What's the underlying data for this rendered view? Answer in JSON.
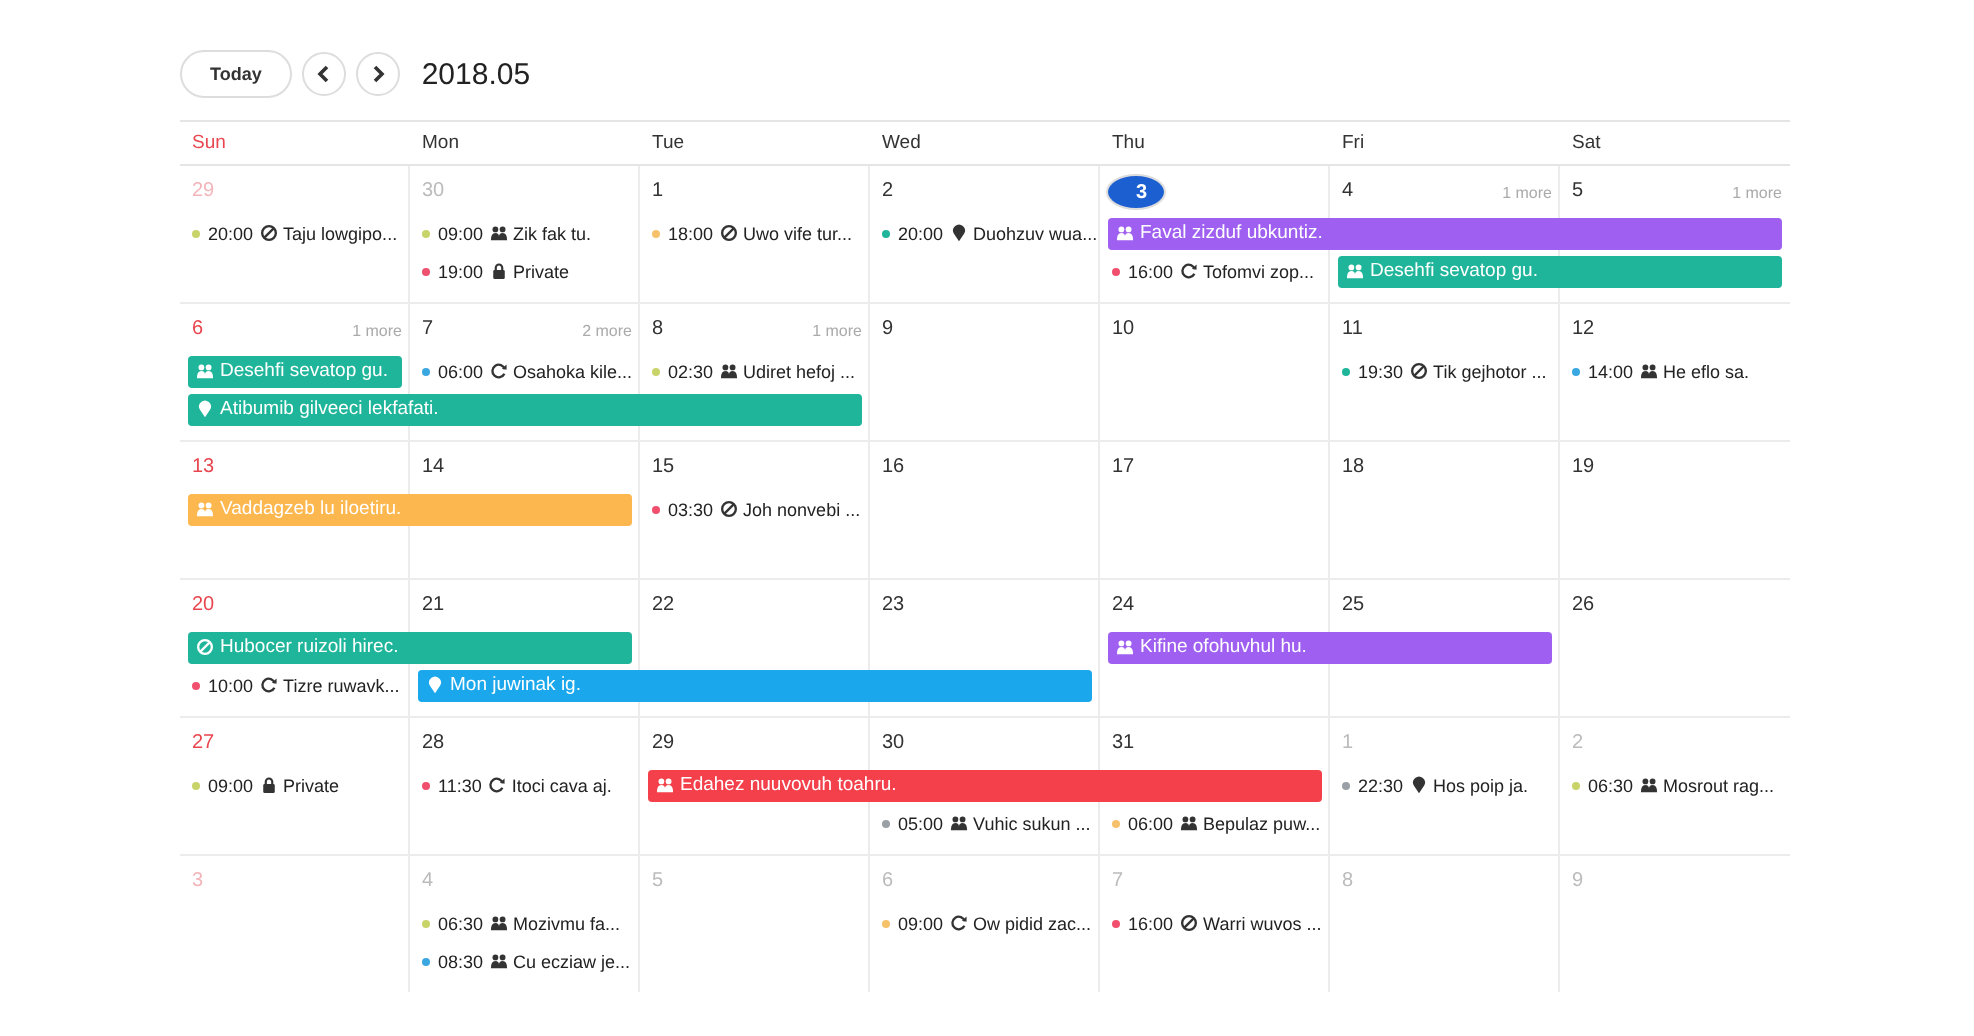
{
  "toolbar": {
    "today_button": "Today",
    "title": "2018.05"
  },
  "weekdays": [
    "Sun",
    "Mon",
    "Tue",
    "Wed",
    "Thu",
    "Fri",
    "Sat"
  ],
  "weeks": [
    {
      "days": [
        {
          "date": "29",
          "other_month": true,
          "today": false
        },
        {
          "date": "30",
          "other_month": true,
          "today": false
        },
        {
          "date": "1",
          "other_month": false,
          "today": false
        },
        {
          "date": "2",
          "other_month": false,
          "today": false
        },
        {
          "date": "3",
          "other_month": false,
          "today": true
        },
        {
          "date": "4",
          "other_month": false,
          "today": false,
          "more": "1 more"
        },
        {
          "date": "5",
          "other_month": false,
          "today": false,
          "more": "1 more"
        }
      ],
      "lanes": [
        [
          {
            "kind": "cancelled",
            "time": "20:00",
            "title": "Taju lowgipo...",
            "color": "#c8d46a"
          },
          {
            "kind": "meeting",
            "time": "09:00",
            "title": "Zik fak tu.",
            "color": "#c8d46a"
          },
          {
            "kind": "cancelled",
            "time": "18:00",
            "title": "Uwo vife tur...",
            "color": "#f5c26b"
          },
          {
            "kind": "location",
            "time": "20:00",
            "title": "Duohzuv wua...",
            "color": "#1fb59a"
          },
          {
            "kind": "meeting",
            "title": "Faval zizduf ubkuntiz.",
            "color": "#9f5ff1"
          },
          {
            "kind": "continued"
          },
          {
            "kind": "continued"
          }
        ],
        [
          {
            "kind": "empty"
          },
          {
            "kind": "private",
            "time": "19:00",
            "title": "Private",
            "color": "#f0506e"
          },
          {
            "kind": "empty"
          },
          {
            "kind": "empty"
          },
          {
            "kind": "recurring",
            "time": "16:00",
            "title": "Tofomvi zop...",
            "color": "#f0506e"
          },
          {
            "kind": "meeting",
            "title": "Desehfi sevatop gu.",
            "color": "#1fb59a"
          },
          {
            "kind": "continued"
          }
        ]
      ]
    },
    {
      "days": [
        {
          "date": "6",
          "other_month": false,
          "today": false,
          "more": "1 more"
        },
        {
          "date": "7",
          "other_month": false,
          "today": false,
          "more": "2 more"
        },
        {
          "date": "8",
          "other_month": false,
          "today": false,
          "more": "1 more"
        },
        {
          "date": "9",
          "other_month": false,
          "today": false
        },
        {
          "date": "10",
          "other_month": false,
          "today": false
        },
        {
          "date": "11",
          "other_month": false,
          "today": false
        },
        {
          "date": "12",
          "other_month": false,
          "today": false
        }
      ],
      "lanes": [
        [
          {
            "kind": "meeting",
            "title": "Desehfi sevatop gu.",
            "color": "#1fb59a"
          },
          {
            "kind": "recurring",
            "time": "06:00",
            "title": "Osahoka kile...",
            "color": "#3aa7e0"
          },
          {
            "kind": "meeting",
            "time": "02:30",
            "title": "Udiret hefoj ...",
            "color": "#c8d46a"
          },
          {
            "kind": "empty"
          },
          {
            "kind": "empty"
          },
          {
            "kind": "cancelled",
            "time": "19:30",
            "title": "Tik gejhotor ...",
            "color": "#1fb59a"
          },
          {
            "kind": "meeting",
            "time": "14:00",
            "title": "He eflo sa.",
            "color": "#3aa7e0"
          }
        ],
        [
          {
            "kind": "location",
            "title": "Atibumib gilveeci lekfafati.",
            "color": "#1fb59a"
          },
          {
            "kind": "continued"
          },
          {
            "kind": "continued"
          }
        ]
      ]
    },
    {
      "days": [
        {
          "date": "13",
          "other_month": false,
          "today": false
        },
        {
          "date": "14",
          "other_month": false,
          "today": false
        },
        {
          "date": "15",
          "other_month": false,
          "today": false
        },
        {
          "date": "16",
          "other_month": false,
          "today": false
        },
        {
          "date": "17",
          "other_month": false,
          "today": false
        },
        {
          "date": "18",
          "other_month": false,
          "today": false
        },
        {
          "date": "19",
          "other_month": false,
          "today": false
        }
      ],
      "lanes": [
        [
          {
            "kind": "meeting",
            "title": "Vaddagzeb lu iloetiru.",
            "color": "#fdb74f"
          },
          {
            "kind": "continued"
          },
          {
            "kind": "cancelled",
            "time": "03:30",
            "title": "Joh nonvebi ...",
            "color": "#f0506e"
          }
        ]
      ]
    },
    {
      "days": [
        {
          "date": "20",
          "other_month": false,
          "today": false
        },
        {
          "date": "21",
          "other_month": false,
          "today": false
        },
        {
          "date": "22",
          "other_month": false,
          "today": false
        },
        {
          "date": "23",
          "other_month": false,
          "today": false
        },
        {
          "date": "24",
          "other_month": false,
          "today": false
        },
        {
          "date": "25",
          "other_month": false,
          "today": false
        },
        {
          "date": "26",
          "other_month": false,
          "today": false
        }
      ],
      "lanes": [
        [
          {
            "kind": "cancelled",
            "title": "Hubocer ruizoli hirec.",
            "color": "#1fb59a"
          },
          {
            "kind": "continued"
          },
          {
            "kind": "empty"
          },
          {
            "kind": "empty"
          },
          {
            "kind": "meeting",
            "title": "Kifine ofohuvhul hu.",
            "color": "#9f5ff1"
          },
          {
            "kind": "continued"
          }
        ],
        [
          {
            "kind": "recurring",
            "time": "10:00",
            "title": "Tizre ruwavk...",
            "color": "#f0506e"
          },
          {
            "kind": "location",
            "title": "Mon juwinak ig.",
            "color": "#1aa7ec"
          },
          {
            "kind": "continued"
          },
          {
            "kind": "continued"
          }
        ]
      ]
    },
    {
      "days": [
        {
          "date": "27",
          "other_month": false,
          "today": false
        },
        {
          "date": "28",
          "other_month": false,
          "today": false
        },
        {
          "date": "29",
          "other_month": false,
          "today": false
        },
        {
          "date": "30",
          "other_month": false,
          "today": false
        },
        {
          "date": "31",
          "other_month": false,
          "today": false
        },
        {
          "date": "1",
          "other_month": true,
          "today": false
        },
        {
          "date": "2",
          "other_month": true,
          "today": false
        }
      ],
      "lanes": [
        [
          {
            "kind": "private",
            "time": "09:00",
            "title": "Private",
            "color": "#c8d46a"
          },
          {
            "kind": "recurring",
            "time": "11:30",
            "title": "Itoci cava aj.",
            "color": "#f0506e"
          },
          {
            "kind": "meeting",
            "title": "Edahez nuuvovuh toahru.",
            "color": "#f4404a"
          },
          {
            "kind": "continued"
          },
          {
            "kind": "continued"
          },
          {
            "kind": "location",
            "time": "22:30",
            "title": "Hos poip ja.",
            "color": "#9aa0a6"
          },
          {
            "kind": "meeting",
            "time": "06:30",
            "title": "Mosrout rag...",
            "color": "#c8d46a"
          }
        ],
        [
          {
            "kind": "empty"
          },
          {
            "kind": "empty"
          },
          {
            "kind": "empty"
          },
          {
            "kind": "meeting",
            "time": "05:00",
            "title": "Vuhic sukun ...",
            "color": "#9aa0a6"
          },
          {
            "kind": "meeting",
            "time": "06:00",
            "title": "Bepulaz puw...",
            "color": "#f5c26b"
          }
        ]
      ]
    },
    {
      "days": [
        {
          "date": "3",
          "other_month": true,
          "today": false
        },
        {
          "date": "4",
          "other_month": true,
          "today": false
        },
        {
          "date": "5",
          "other_month": true,
          "today": false
        },
        {
          "date": "6",
          "other_month": true,
          "today": false
        },
        {
          "date": "7",
          "other_month": true,
          "today": false
        },
        {
          "date": "8",
          "other_month": true,
          "today": false
        },
        {
          "date": "9",
          "other_month": true,
          "today": false
        }
      ],
      "lanes": [
        [
          {
            "kind": "empty"
          },
          {
            "kind": "meeting",
            "time": "06:30",
            "title": "Mozivmu fa...",
            "color": "#c8d46a"
          },
          {
            "kind": "empty"
          },
          {
            "kind": "recurring",
            "time": "09:00",
            "title": "Ow pidid zac...",
            "color": "#f5c26b"
          },
          {
            "kind": "cancelled",
            "time": "16:00",
            "title": "Warri wuvos ...",
            "color": "#f0506e"
          }
        ],
        [
          {
            "kind": "empty"
          },
          {
            "kind": "meeting",
            "time": "08:30",
            "title": "Cu ecziaw je...",
            "color": "#3aa7e0"
          }
        ]
      ]
    }
  ]
}
